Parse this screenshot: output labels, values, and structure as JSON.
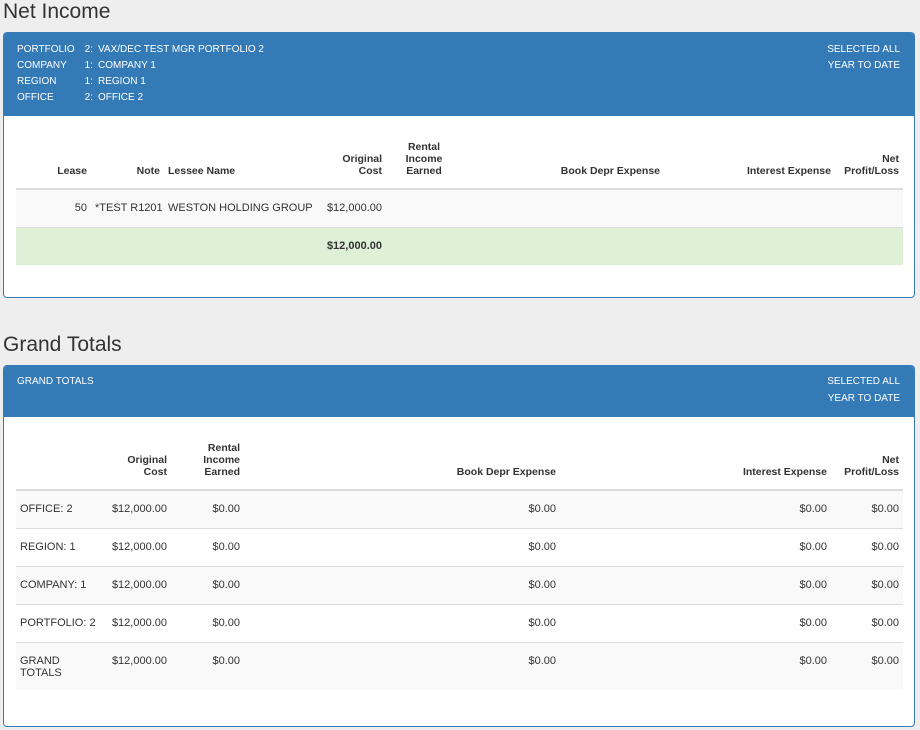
{
  "net_income": {
    "title": "Net Income",
    "header": {
      "rows": [
        {
          "label": "PORTFOLIO",
          "num": "2:",
          "value": "VAX/DEC TEST MGR PORTFOLIO 2"
        },
        {
          "label": "COMPANY",
          "num": "1:",
          "value": "COMPANY 1"
        },
        {
          "label": "REGION",
          "num": "1:",
          "value": "REGION 1"
        },
        {
          "label": "OFFICE",
          "num": "2:",
          "value": "OFFICE 2"
        }
      ],
      "selected": "SELECTED ALL",
      "period": "YEAR TO DATE"
    },
    "columns": {
      "lease": "Lease",
      "note": "Note",
      "lessee": "Lessee Name",
      "original_cost_1": "Original",
      "original_cost_2": "Cost",
      "rental_1": "Rental",
      "rental_2": "Income",
      "rental_3": "Earned",
      "book_depr": "Book Depr Expense",
      "interest": "Interest Expense",
      "net_1": "Net",
      "net_2": "Profit/Loss"
    },
    "rows": [
      {
        "lease": "50",
        "note": "*TEST R1201",
        "lessee": "WESTON HOLDING GROUP",
        "original_cost": "$12,000.00",
        "rental": "",
        "book_depr": "",
        "interest": "",
        "net": ""
      }
    ],
    "total": {
      "original_cost": "$12,000.00"
    }
  },
  "grand_totals": {
    "title": "Grand Totals",
    "header": {
      "label": "GRAND TOTALS",
      "selected": "SELECTED ALL",
      "period": "YEAR TO DATE"
    },
    "columns": {
      "original_cost_1": "Original",
      "original_cost_2": "Cost",
      "rental_1": "Rental",
      "rental_2": "Income",
      "rental_3": "Earned",
      "book_depr": "Book Depr Expense",
      "interest": "Interest Expense",
      "net_1": "Net",
      "net_2": "Profit/Loss"
    },
    "rows": [
      {
        "label": "OFFICE: 2",
        "original_cost": "$12,000.00",
        "rental": "$0.00",
        "book_depr": "$0.00",
        "interest": "$0.00",
        "net": "$0.00"
      },
      {
        "label": "REGION: 1",
        "original_cost": "$12,000.00",
        "rental": "$0.00",
        "book_depr": "$0.00",
        "interest": "$0.00",
        "net": "$0.00"
      },
      {
        "label": "COMPANY: 1",
        "original_cost": "$12,000.00",
        "rental": "$0.00",
        "book_depr": "$0.00",
        "interest": "$0.00",
        "net": "$0.00"
      },
      {
        "label": "PORTFOLIO: 2",
        "original_cost": "$12,000.00",
        "rental": "$0.00",
        "book_depr": "$0.00",
        "interest": "$0.00",
        "net": "$0.00"
      },
      {
        "label_1": "GRAND",
        "label_2": "TOTALS",
        "original_cost": "$12,000.00",
        "rental": "$0.00",
        "book_depr": "$0.00",
        "interest": "$0.00",
        "net": "$0.00"
      }
    ]
  },
  "colors": {
    "header_bg": "#337ab7",
    "total_row_bg": "#dff0d8",
    "page_bg": "#eeeeee"
  }
}
